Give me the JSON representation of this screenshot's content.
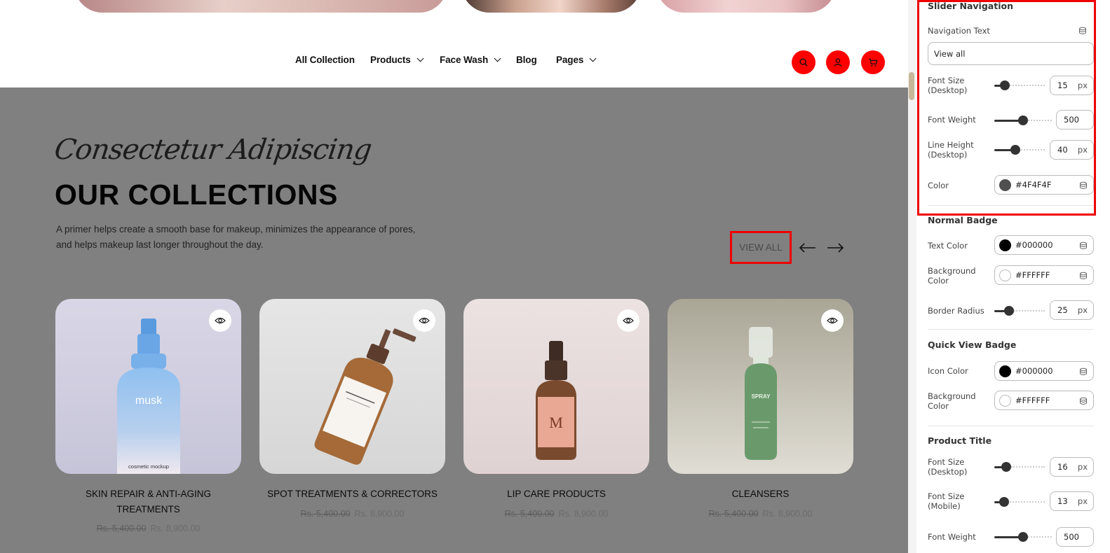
{
  "nav": {
    "items": [
      {
        "label": "All Collection",
        "has_dropdown": false
      },
      {
        "label": "Products",
        "has_dropdown": true
      },
      {
        "label": "Face Wash",
        "has_dropdown": true
      },
      {
        "label": "Blog",
        "has_dropdown": false
      },
      {
        "label": "Pages",
        "has_dropdown": true
      }
    ],
    "icons": [
      "search-icon",
      "user-icon",
      "cart-icon"
    ],
    "icon_bg": "#FF0000"
  },
  "section": {
    "script_title": "Consectetur Adipiscing",
    "title": "OUR COLLECTIONS",
    "description": "A primer helps create a smooth base for makeup, minimizes the appearance of pores, and helps makeup last longer throughout the day.",
    "view_all": "VIEW ALL",
    "overlay_color": "#808080"
  },
  "products": [
    {
      "title": "SKIN REPAIR & ANTI-AGING TREATMENTS",
      "old_price": "Rs. 5,400.00",
      "price": "Rs. 8,900.00",
      "bottle_brand": "musk",
      "bottle_caption": "cosmetic mockup"
    },
    {
      "title": "SPOT TREATMENTS & CORRECTORS",
      "old_price": "Rs. 5,400.00",
      "price": "Rs. 8,900.00",
      "bottle_brand": "",
      "bottle_caption": ""
    },
    {
      "title": "LIP CARE PRODUCTS",
      "old_price": "Rs. 5,400.00",
      "price": "Rs. 8,900.00",
      "bottle_brand": "M",
      "bottle_caption": ""
    },
    {
      "title": "CLEANSERS",
      "old_price": "Rs. 5,400.00",
      "price": "Rs. 8,900.00",
      "bottle_brand": "SPRAY",
      "bottle_caption": ""
    }
  ],
  "panel": {
    "slider_navigation": {
      "heading": "Slider Navigation",
      "navigation_text_label": "Navigation Text",
      "navigation_text_value": "View all",
      "font_size_label": "Font Size (Desktop)",
      "font_size_value": "15",
      "font_weight_label": "Font Weight",
      "font_weight_value": "500",
      "line_height_label": "Line Height (Desktop)",
      "line_height_value": "40",
      "color_label": "Color",
      "color_value": "#4F4F4F",
      "unit": "px"
    },
    "normal_badge": {
      "heading": "Normal Badge",
      "text_color_label": "Text Color",
      "text_color_value": "#000000",
      "bg_color_label": "Background Color",
      "bg_color_value": "#FFFFFF",
      "border_radius_label": "Border Radius",
      "border_radius_value": "25",
      "unit": "px"
    },
    "quick_view_badge": {
      "heading": "Quick View Badge",
      "icon_color_label": "Icon Color",
      "icon_color_value": "#000000",
      "bg_color_label": "Background Color",
      "bg_color_value": "#FFFFFF"
    },
    "product_title": {
      "heading": "Product Title",
      "font_size_desktop_label": "Font Size (Desktop)",
      "font_size_desktop_value": "16",
      "font_size_mobile_label": "Font Size (Mobile)",
      "font_size_mobile_value": "13",
      "font_weight_label": "Font Weight",
      "font_weight_value": "500",
      "unit": "px"
    }
  }
}
